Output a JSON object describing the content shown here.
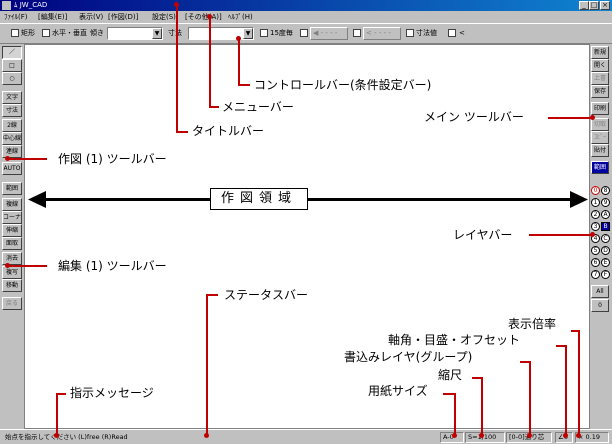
{
  "title": "ﾑ JW_CAD",
  "window_buttons": [
    "_",
    "□",
    "×"
  ],
  "menu": [
    "ﾌｧｲﾙ(F)",
    "[編集(E)]",
    "表示(V)",
    "[作図(D)]",
    "設定(S)",
    "[その他(A)]",
    "ﾍﾙﾌﾟ(H)"
  ],
  "control_bar": {
    "rect_label": "矩形",
    "hv_label": "水平・垂直",
    "tilt_label": "傾き",
    "dim_label": "寸法",
    "deg15_label": "15度毎",
    "btn1": "◀ - - - -",
    "btn2": "< - - - -",
    "dim_value_label": "寸法値",
    "lt_label": "<"
  },
  "left_toolbar": [
    "／",
    "□",
    "○",
    "文字",
    "寸法",
    "2線",
    "中心線",
    "連線",
    "AUTO",
    "範囲",
    "複線",
    "コーナー",
    "伸縮",
    "面取",
    "消去",
    "複写",
    "移動",
    "戻る"
  ],
  "right_toolbar": [
    "新規",
    "開く",
    "上書",
    "保存",
    "印刷",
    "切取",
    "ｺﾋﾟｰ",
    "貼付",
    "範囲"
  ],
  "layers": [
    "0",
    "8",
    "1",
    "9",
    "2",
    "A",
    "3",
    "B",
    "4",
    "C",
    "5",
    "D",
    "6",
    "E",
    "7",
    "F"
  ],
  "layer_all": "All",
  "layer_group": "0",
  "status": {
    "message": "始点を指示してください (L)free (R)Read",
    "paper": "A-0",
    "scale": "S=1/100",
    "layer": "[0-0]通り芯",
    "angle": "∠0",
    "zoom": "× 0.19"
  },
  "annotations": {
    "control_bar": "コントロールバー(条件設定バー)",
    "menu_bar": "メニューバー",
    "title_bar": "タイトルバー",
    "main_toolbar": "メイン ツールバー",
    "draw_toolbar": "作図 (1) ツールバー",
    "drawing_area": "作図領域",
    "layer_bar": "レイヤバー",
    "edit_toolbar": "編集 (1) ツールバー",
    "status_bar": "ステータスバー",
    "zoom": "表示倍率",
    "axis": "軸角・目盛・オフセット",
    "write_layer": "書込みレイヤ(グループ)",
    "scale": "縮尺",
    "paper": "用紙サイズ",
    "message": "指示メッセージ"
  },
  "colors": {
    "title_bar": "#000080",
    "leader": "#c00000",
    "canvas": "#ffffff",
    "chrome": "#c0c0c0"
  }
}
